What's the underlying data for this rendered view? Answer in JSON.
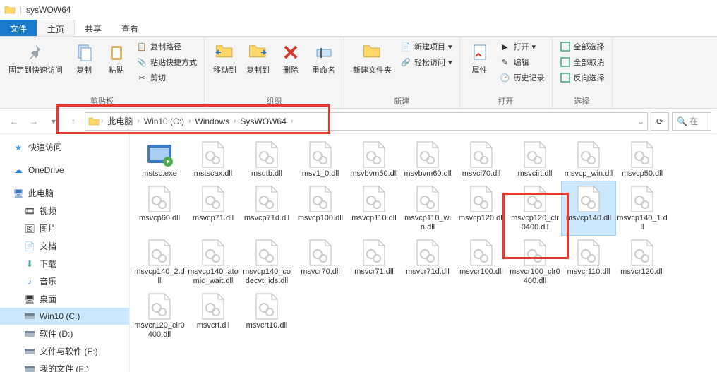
{
  "titlebar": {
    "title": "sysWOW64"
  },
  "tabs": {
    "file": "文件",
    "home": "主页",
    "share": "共享",
    "view": "查看"
  },
  "ribbon": {
    "pin": "固定到快速访问",
    "copy": "复制",
    "paste": "粘贴",
    "copypath": "复制路径",
    "pasteshortcut": "粘贴快捷方式",
    "cut": "剪切",
    "moveto": "移动到",
    "copyto": "复制到",
    "delete": "删除",
    "rename": "重命名",
    "newfolder": "新建文件夹",
    "newitem": "新建项目",
    "easyaccess": "轻松访问",
    "properties": "属性",
    "open": "打开",
    "edit": "编辑",
    "history": "历史记录",
    "selectall": "全部选择",
    "selectnone": "全部取消",
    "invertsel": "反向选择",
    "grp_clipboard": "剪贴板",
    "grp_organize": "组织",
    "grp_new": "新建",
    "grp_open": "打开",
    "grp_select": "选择"
  },
  "breadcrumb": [
    "此电脑",
    "Win10 (C:)",
    "Windows",
    "SysWOW64"
  ],
  "search_placeholder": "在",
  "sidebar": {
    "quickaccess": "快速访问",
    "onedrive": "OneDrive",
    "thispc": "此电脑",
    "videos": "视频",
    "pictures": "图片",
    "documents": "文档",
    "downloads": "下载",
    "music": "音乐",
    "desktop": "桌面",
    "c": "Win10 (C:)",
    "d": "软件 (D:)",
    "e": "文件与软件 (E:)",
    "f": "我的文件 (F:)"
  },
  "files": [
    {
      "n": "mstsc.exe",
      "t": "exe"
    },
    {
      "n": "mstscax.dll",
      "t": "dll"
    },
    {
      "n": "msutb.dll",
      "t": "dll"
    },
    {
      "n": "msv1_0.dll",
      "t": "dll"
    },
    {
      "n": "msvbvm50.dll",
      "t": "dll"
    },
    {
      "n": "msvbvm60.dll",
      "t": "dll"
    },
    {
      "n": "msvci70.dll",
      "t": "dll"
    },
    {
      "n": "msvcirt.dll",
      "t": "dll"
    },
    {
      "n": "msvcp_win.dll",
      "t": "dll"
    },
    {
      "n": "msvcp50.dll",
      "t": "dll"
    },
    {
      "n": "msvcp60.dll",
      "t": "dll"
    },
    {
      "n": "msvcp71.dll",
      "t": "dll"
    },
    {
      "n": "msvcp71d.dll",
      "t": "dll"
    },
    {
      "n": "msvcp100.dll",
      "t": "dll"
    },
    {
      "n": "msvcp110.dll",
      "t": "dll"
    },
    {
      "n": "msvcp110_win.dll",
      "t": "dll"
    },
    {
      "n": "msvcp120.dll",
      "t": "dll"
    },
    {
      "n": "msvcp120_clr0400.dll",
      "t": "dll"
    },
    {
      "n": "msvcp140.dll",
      "t": "dll",
      "sel": true
    },
    {
      "n": "msvcp140_1.dll",
      "t": "dll"
    },
    {
      "n": "msvcp140_2.dll",
      "t": "dll"
    },
    {
      "n": "msvcp140_atomic_wait.dll",
      "t": "dll"
    },
    {
      "n": "msvcp140_codecvt_ids.dll",
      "t": "dll"
    },
    {
      "n": "msvcr70.dll",
      "t": "dll"
    },
    {
      "n": "msvcr71.dll",
      "t": "dll"
    },
    {
      "n": "msvcr71d.dll",
      "t": "dll"
    },
    {
      "n": "msvcr100.dll",
      "t": "dll"
    },
    {
      "n": "msvcr100_clr0400.dll",
      "t": "dll"
    },
    {
      "n": "msvcr110.dll",
      "t": "dll"
    },
    {
      "n": "msvcr120.dll",
      "t": "dll"
    },
    {
      "n": "msvcr120_clr0400.dll",
      "t": "dll"
    },
    {
      "n": "msvcrt.dll",
      "t": "dll"
    },
    {
      "n": "msvcrt10.dll",
      "t": "dll"
    }
  ]
}
